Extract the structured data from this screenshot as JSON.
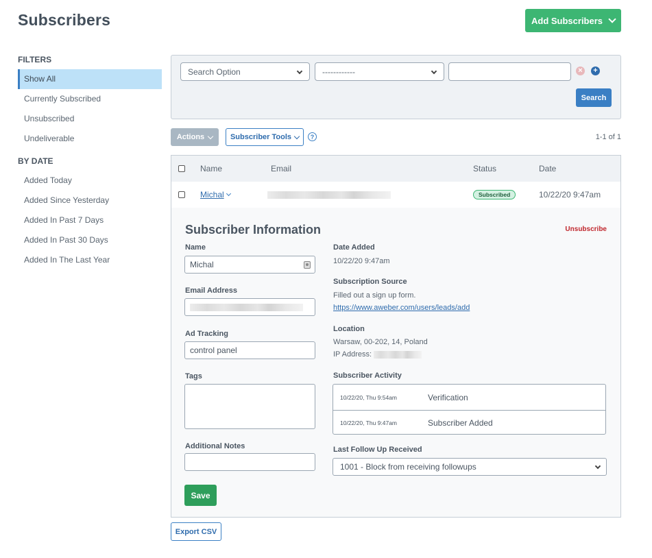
{
  "page": {
    "title": "Subscribers",
    "add_button": "Add Subscribers"
  },
  "sidebar": {
    "filters_heading": "FILTERS",
    "filters": [
      {
        "label": "Show All",
        "active": true
      },
      {
        "label": "Currently Subscribed"
      },
      {
        "label": "Unsubscribed"
      },
      {
        "label": "Undeliverable"
      }
    ],
    "by_date_heading": "BY DATE",
    "by_date": [
      {
        "label": "Added Today"
      },
      {
        "label": "Added Since Yesterday"
      },
      {
        "label": "Added In Past 7 Days"
      },
      {
        "label": "Added In Past 30 Days"
      },
      {
        "label": "Added In The Last Year"
      }
    ]
  },
  "search": {
    "option_select": "Search Option",
    "operator_select": "------------",
    "value": "",
    "search_button": "Search",
    "remove_icon": "x-circle-icon",
    "add_icon": "plus-circle-icon"
  },
  "toolbar": {
    "actions": "Actions",
    "subscriber_tools": "Subscriber Tools",
    "help_icon": "question-circle-icon",
    "pagination": "1-1 of 1"
  },
  "table": {
    "columns": [
      "Name",
      "Email",
      "Status",
      "Date"
    ],
    "rows": [
      {
        "name": "Michal",
        "email": "[redacted]",
        "status": "Subscribed",
        "date": "10/22/20 9:47am"
      }
    ]
  },
  "detail": {
    "title": "Subscriber Information",
    "unsubscribe": "Unsubscribe",
    "name_label": "Name",
    "name_value": "Michal",
    "email_label": "Email Address",
    "ad_tracking_label": "Ad Tracking",
    "ad_tracking_value": "control panel",
    "tags_label": "Tags",
    "notes_label": "Additional Notes",
    "save": "Save",
    "date_added_label": "Date Added",
    "date_added_value": "10/22/20 9:47am",
    "source_label": "Subscription Source",
    "source_text": "Filled out a sign up form.",
    "source_url": "https://www.aweber.com/users/leads/add",
    "location_label": "Location",
    "location_value": "Warsaw, 00-202, 14, Poland",
    "ip_label": "IP Address:",
    "activity_label": "Subscriber Activity",
    "activity": [
      {
        "date": "10/22/20, Thu 9:54am",
        "event": "Verification"
      },
      {
        "date": "10/22/20, Thu 9:47am",
        "event": "Subscriber Added"
      }
    ],
    "followup_label": "Last Follow Up Received",
    "followup_value": "1001 - Block from receiving followups"
  },
  "footer": {
    "export": "Export CSV"
  },
  "colors": {
    "brand_green": "#3db673",
    "save_green": "#2e9e5b",
    "primary_blue": "#3a7fc4",
    "active_filter_bg": "#bde1f8",
    "danger_red": "#c0272d"
  }
}
